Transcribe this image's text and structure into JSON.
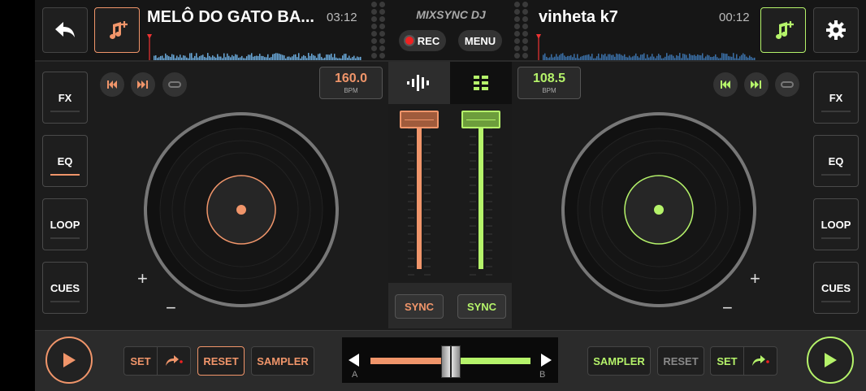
{
  "app": {
    "name": "MIXSYNC DJ",
    "rec_label": "REC",
    "menu_label": "MENU"
  },
  "colors": {
    "deck_a": "#f0956a",
    "deck_b": "#b5f36a"
  },
  "deck_a": {
    "title": "MELÔ DO GATO BA...",
    "time": "03:12",
    "bpm": "160.0",
    "bpm_unit": "BPM",
    "side_buttons": [
      "FX",
      "EQ",
      "LOOP",
      "CUES"
    ],
    "sync_label": "SYNC",
    "bottom": {
      "set": "SET",
      "reset": "RESET",
      "sampler": "SAMPLER"
    }
  },
  "deck_b": {
    "title": "vinheta k7",
    "time": "00:12",
    "bpm": "108.5",
    "bpm_unit": "BPM",
    "side_buttons": [
      "FX",
      "EQ",
      "LOOP",
      "CUES"
    ],
    "sync_label": "SYNC",
    "bottom": {
      "set": "SET",
      "reset": "RESET",
      "sampler": "SAMPLER"
    }
  },
  "crossfader": {
    "left_label": "A",
    "right_label": "B",
    "position": 0.5
  },
  "pitch_sliders": {
    "deck_a_level": 1.0,
    "deck_b_level": 1.0
  },
  "icons": {
    "plus": "+",
    "minus": "−"
  }
}
